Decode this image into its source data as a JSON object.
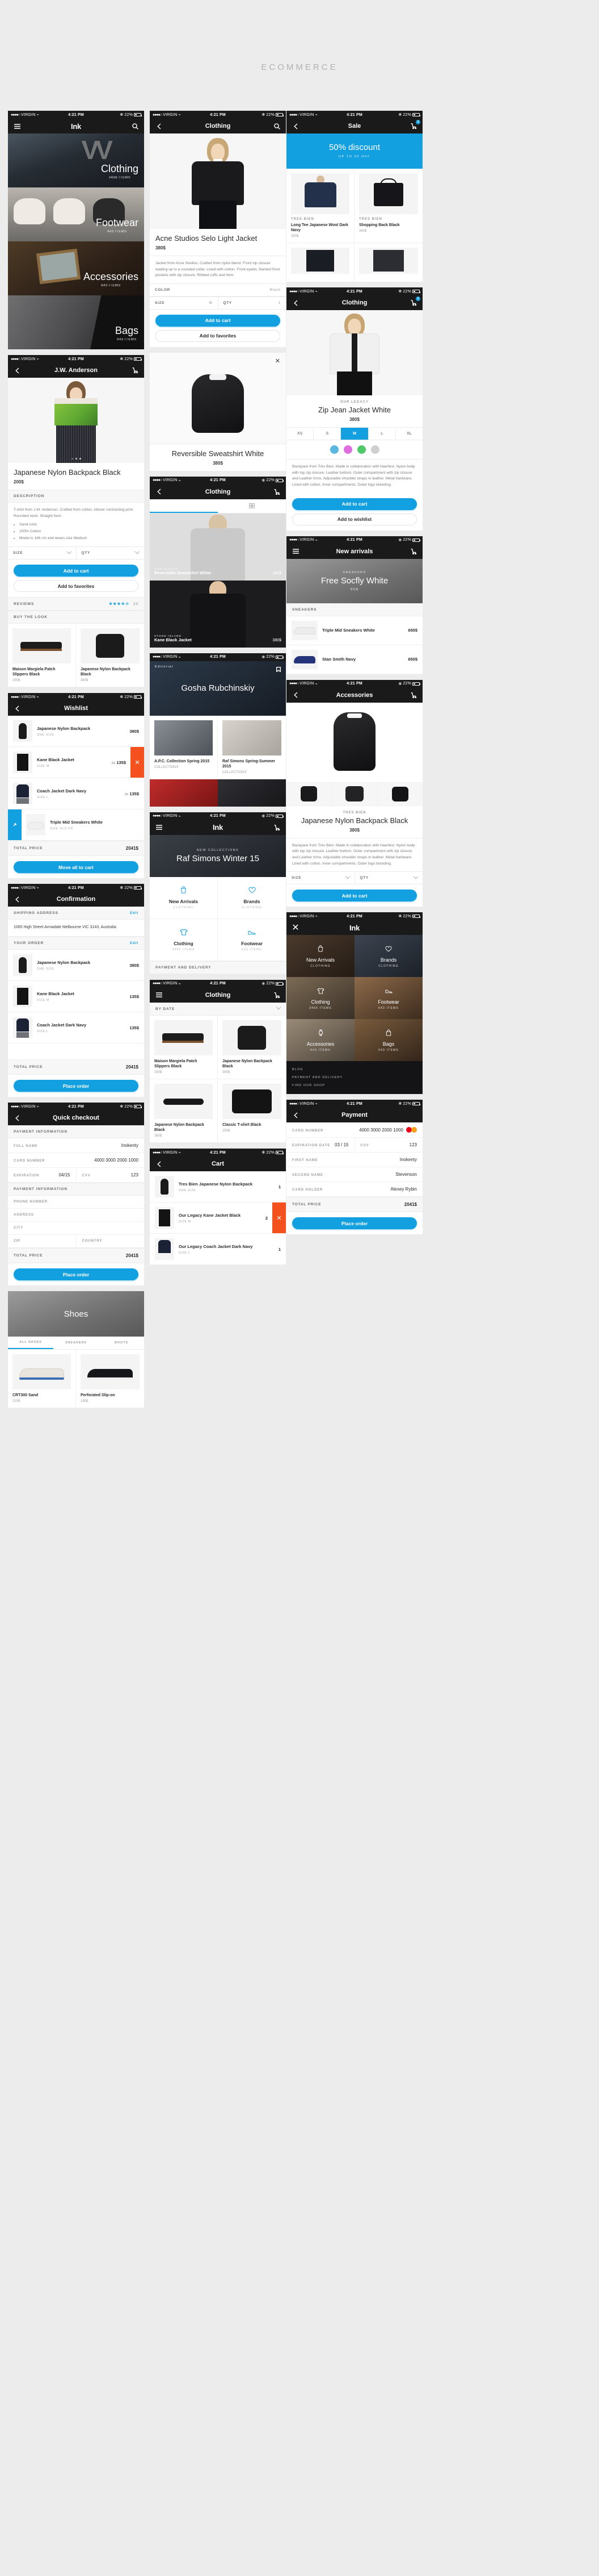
{
  "page": {
    "title": "ECOMMERCE"
  },
  "status": {
    "carrier": "VIRGIN",
    "time": "4:21 PM",
    "battery": "22%"
  },
  "brand": {
    "name": "Ink"
  },
  "home": {
    "nav_title": "Ink",
    "categories": [
      {
        "name": "Clothing",
        "items": "3456 ITEMS"
      },
      {
        "name": "Footwear",
        "items": "643 ITEMS"
      },
      {
        "name": "Accessories",
        "items": "643 ITEMS"
      },
      {
        "name": "Bags",
        "items": "643 ITEMS"
      }
    ]
  },
  "product_jw": {
    "nav_title": "J.W. Anderson",
    "title": "Japanese Nylon Backpack Black",
    "price": "200$",
    "desc_header": "DESCRIPTION",
    "description": "T-shirt from J.W. Anderson. Crafted from cotton. Allover contrasting print. Rounded neck. Straight hem.",
    "bullets": [
      "Sand color",
      "100% Cotton",
      "Model is 186 cm and wears size Medium"
    ],
    "size_label": "SIZE",
    "qty_label": "QTY",
    "add_to_cart": "Add to cart",
    "add_to_favorites": "Add to favorites",
    "reviews_header": "REVIEWS",
    "reviews_count": "22",
    "stars": "★★★★☆",
    "buy_the_look": "BUY THE LOOK",
    "look_items": [
      {
        "name": "Maison Margiela Patch Slippers Black",
        "price": "290$"
      },
      {
        "name": "Japanese Nylon Backpack Black",
        "price": "380$"
      }
    ]
  },
  "wishlist": {
    "nav_title": "Wishlist",
    "items": [
      {
        "name": "Japanese Nylon Backpack",
        "meta": "ONE SIZE",
        "price": "380$",
        "qty": ""
      },
      {
        "name": "Kane Black Jacket",
        "meta": "SIZE M",
        "price": "135$",
        "qty": "2X"
      },
      {
        "name": "Coach Jacket Dark Navy",
        "meta": "SIZE L",
        "price": "135$",
        "qty": "2X"
      },
      {
        "name": "Triple Mid Sneakers White",
        "meta": "SIZE 10,5 US",
        "price": "",
        "qty": ""
      }
    ],
    "total_label": "TOTAL PRICE",
    "total_value": "2041$",
    "cta": "Move all to cart"
  },
  "confirmation": {
    "nav_title": "Confirmation",
    "shipping_header": "SHIPPING ADDRESS",
    "address": "1065 High Street Armadale Melbourne VIC 3143, Australia",
    "order_header": "YOUR ORDER",
    "edit": "Edit",
    "items": [
      {
        "name": "Japanese Nylon Backpack",
        "meta": "ONE SIZE",
        "price": "380$"
      },
      {
        "name": "Kane Black Jacket",
        "meta": "SIZE M",
        "price": "135$"
      },
      {
        "name": "Coach Jacket Dark Navy",
        "meta": "SIZE L",
        "price": "135$"
      }
    ],
    "total_label": "TOTAL PRICE",
    "total_value": "2041$",
    "cta": "Place order"
  },
  "quick_checkout": {
    "nav_title": "Quick checkout",
    "payment_header": "PAYMENT INFORMATION",
    "fields": [
      {
        "label": "FULL NAME",
        "value": "Inokenty"
      },
      {
        "label": "CARD NUMBER",
        "value": "4000 3000 2000 1000"
      }
    ],
    "expiration_label": "EXPIRATION",
    "expiration_value": "04/15",
    "cvv_label": "CVV",
    "cvv_value": "123",
    "contact_header": "PAYMENT INFORMATION",
    "phone_label": "PHONE NUMBER",
    "address_label": "ADDRESS",
    "city_label": "CITY",
    "zip_label": "ZIP",
    "country_label": "COUNTRY",
    "total_label": "TOTAL PRICE",
    "total_value": "2041$",
    "cta": "Place order"
  },
  "shoes_menu": {
    "title": "Shoes",
    "tab_all": "ALL SHOES",
    "tab_sneakers": "SNEAKERS",
    "tab_boots": "BOOTS",
    "items": [
      {
        "name": "CRT300 Sand",
        "price": "210$"
      },
      {
        "name": "Perforated Slip-on",
        "price": "190$"
      }
    ]
  },
  "acne": {
    "nav_title": "Clothing",
    "title": "Acne Studios Selo Light Jacket",
    "price": "380$",
    "description": "Jacket from Acne Studios. Crafted from nylon blend. Front zip closure leading up to a rounded collar. Lined with cotton. Front eyelet. Slanted front pockets with zip closure. Ribbed cuffs and hem.",
    "color_label": "COLOR",
    "color_value": "Black",
    "size_label": "SIZE",
    "size_value": "M",
    "qty_label": "QTY",
    "qty_value": "1",
    "add_to_cart": "Add to cart",
    "add_to_favorites": "Add to favorites"
  },
  "backpack_modal": {
    "title": "Reversible Sweatshirt White",
    "price": "380$"
  },
  "clothing_list": {
    "nav_title": "Clothing",
    "items": [
      {
        "name": "Reversible Sweatshirt White",
        "price": "380$",
        "brand": "OUR LEGACY"
      },
      {
        "name": "Kane Black Jacket",
        "price": "380$",
        "brand": "STONE ISLAND"
      }
    ]
  },
  "editorial": {
    "tag": "Editorial",
    "title": "Gosha Rubchinskiy",
    "items": [
      {
        "name": "A.P.C. Collection Spring 2015",
        "meta": "COLLECTIONS"
      },
      {
        "name": "Raf Simons Spring-Summer 2015",
        "meta": "COLLECTIONS"
      }
    ]
  },
  "ink_menu": {
    "nav_title": "Ink",
    "promo_tag": "NEW COLLECTIONS",
    "promo_title": "Raf Simons Winter 15",
    "tiles": [
      {
        "name": "New Arrivals",
        "meta": "CLOTHING",
        "icon": "bag-icon"
      },
      {
        "name": "Brands",
        "meta": "CLOTHING",
        "icon": "heart-icon"
      },
      {
        "name": "Clothing",
        "meta": "3456 ITEMS",
        "icon": "shirt-icon"
      },
      {
        "name": "Footwear",
        "meta": "643 ITEMS",
        "icon": "shoe-icon"
      }
    ],
    "section": "PAYMENT AND DELIVERY"
  },
  "cart": {
    "nav_title": "Cart",
    "items": [
      {
        "name": "Tres Bien Japanese Nylon Backpack",
        "meta": "ONE SIZE",
        "qty": "1"
      },
      {
        "name": "Our Legacy Kane Jacket Black",
        "meta": "SIZE M",
        "qty": "2"
      },
      {
        "name": "Our Legacy Coach Jacket Dark Navy",
        "meta": "SIZE L",
        "qty": "1"
      }
    ]
  },
  "sale": {
    "nav_title": "Sale",
    "cart_count": "3",
    "banner_title": "50% discount",
    "banner_sub": "UP TO 50 OFF",
    "items": [
      {
        "brand": "TRES BIEN",
        "name": "Long Tee Japanese Wool Dark Navy",
        "price": "380$"
      },
      {
        "brand": "TRES BIEN",
        "name": "Shopping Back Black",
        "price": "380$"
      }
    ]
  },
  "zip_jacket": {
    "nav_title": "Clothing",
    "brand": "OUR LEGACY",
    "title": "Zip Jean Jacket White",
    "price": "380$",
    "sizes": [
      "XS",
      "S",
      "M",
      "L",
      "XL"
    ],
    "selected_size": "M",
    "colors": [
      "#5bb6e0",
      "#e06ee0",
      "#4fc96a",
      "#cfcfcf"
    ],
    "description": "Backpack from Très Bien. Made in collaboration with Haerfest. Nylon body with top zip closure. Leather bottom. Outer compartment with zip closure and Leather trims. Adjustable shoulder straps in leather. Metal hardware. Lined with cotton. Inner compartments. Outer logo branding.",
    "add_to_cart": "Add to cart",
    "add_to_wishlist": "Add to wishlist"
  },
  "new_arrivals": {
    "nav_title": "New arrivals",
    "promo_kicker": "SNEAKERS",
    "promo_title": "Free Socfly White",
    "promo_price": "95$",
    "section": "SNEAKERS",
    "items": [
      {
        "name": "Triple Mid Sneakers White",
        "price": "650$"
      },
      {
        "name": "Stan Smith Navy",
        "price": "650$"
      }
    ]
  },
  "accessories": {
    "nav_title": "Accessories",
    "brand": "TRES BIEN",
    "title": "Japanese Nylon Backpack Black",
    "price": "380$",
    "description": "Backpack from Très Bien. Made in collaboration with Haerfest. Nylon body with top zip closure. Leather bottom. Outer compartment with zip closure and Leather trims. Adjustable shoulder straps in leather. Metal hardware. Lined with cotton. Inner compartments. Outer logo branding.",
    "size_label": "SIZE",
    "qty_label": "QTY",
    "add_to_cart": "Add to cart"
  },
  "dark_menu": {
    "nav_title": "Ink",
    "tiles": [
      {
        "name": "New Arrivals",
        "meta": "CLOTHING",
        "icon": "bag-icon"
      },
      {
        "name": "Brands",
        "meta": "CLOTHING",
        "icon": "heart-icon"
      },
      {
        "name": "Clothing",
        "meta": "3456 ITEMS",
        "icon": "shirt-icon"
      },
      {
        "name": "Footwear",
        "meta": "643 ITEMS",
        "icon": "shoe-icon"
      },
      {
        "name": "Accessories",
        "meta": "643 ITEMS",
        "icon": "watch-icon"
      },
      {
        "name": "Bags",
        "meta": "643 ITEMS",
        "icon": "bag2-icon"
      }
    ],
    "links": [
      "BLOG",
      "PAYMENT AND DELIVERY",
      "FIND OUR SHOP"
    ]
  },
  "payment": {
    "nav_title": "Payment",
    "card_number_label": "CARD NUMBER",
    "card_number_value": "4000 3000 2000 1000",
    "expiration_label": "EXPIRATION DATE",
    "expiration_value": "03 / 15",
    "cvv_label": "CVV",
    "cvv_value": "123",
    "first_name_label": "FIRST NAME",
    "first_name_value": "Inokenty",
    "second_name_label": "SECOND NAME",
    "second_name_value": "Stevenson",
    "holder_label": "CARD HOLDER",
    "holder_value": "Alexey Rybin",
    "total_label": "TOTAL PRICE",
    "total_value": "2041$",
    "cta": "Place order"
  }
}
